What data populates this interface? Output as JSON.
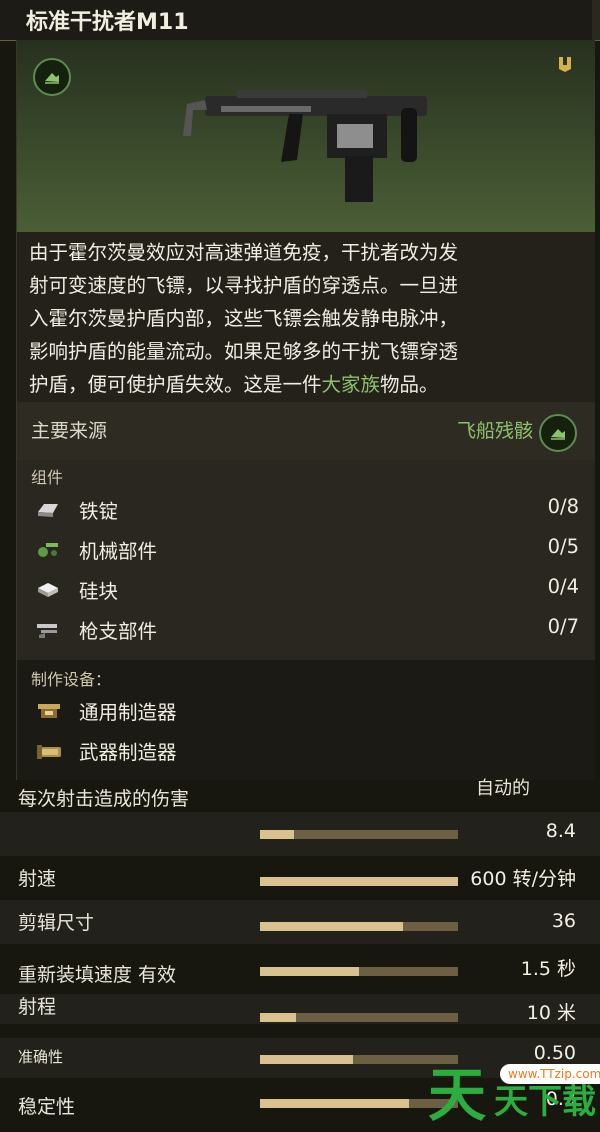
{
  "header": {
    "title": "标准干扰者M11"
  },
  "item": {
    "description_lines": [
      "由于霍尔茨曼效应对高速弹道免疫，干扰者改为发",
      "射可变速度的飞镖，以寻找护盾的穿透点。一旦进",
      "入霍尔茨曼护盾内部，这些飞镖会触发静电脉冲，",
      "影响护盾的能量流动。如果足够多的干扰飞镖穿透"
    ],
    "description_last_prefix": "护盾，便可使护盾失效。这是一件",
    "description_highlight": "大家族",
    "description_last_suffix": "物品。",
    "highlight_color": "#8fc06e"
  },
  "source": {
    "label": "主要来源",
    "value": "飞船残骸"
  },
  "components": {
    "title": "组件",
    "items": [
      {
        "name": "铁锭",
        "count": "0/8",
        "icon": "iron-ingot-icon"
      },
      {
        "name": "机械部件",
        "count": "0/5",
        "icon": "mechanical-parts-icon"
      },
      {
        "name": "硅块",
        "count": "0/4",
        "icon": "silicon-block-icon"
      },
      {
        "name": "枪支部件",
        "count": "0/7",
        "icon": "gun-parts-icon"
      }
    ]
  },
  "fabrication": {
    "title": "制作设备：",
    "items": [
      {
        "name": "通用制造器",
        "icon": "generic-fabricator-icon"
      },
      {
        "name": "武器制造器",
        "icon": "weapon-fabricator-icon"
      }
    ]
  },
  "stats": {
    "cutoff_text": "自动的",
    "rows": [
      {
        "name": "每次射击造成的伤害",
        "value": "8.4",
        "fill": 0.17
      },
      {
        "name": "射速",
        "value": "600 转/分钟",
        "fill": 1.0
      },
      {
        "name": "剪辑尺寸",
        "value": "36",
        "fill": 0.72
      },
      {
        "name": "重新装填速度 有效",
        "value": "1.5 秒",
        "fill": 0.5
      },
      {
        "name": "射程",
        "value": "10 米",
        "fill": 0.18
      },
      {
        "name": "准确性",
        "value": "0.50",
        "fill": 0.47
      },
      {
        "name": "稳定性",
        "value": "0.3",
        "fill": 0.75
      }
    ]
  },
  "watermark": {
    "big": "天",
    "small": "天下载",
    "site": "www.TTzip.com"
  }
}
